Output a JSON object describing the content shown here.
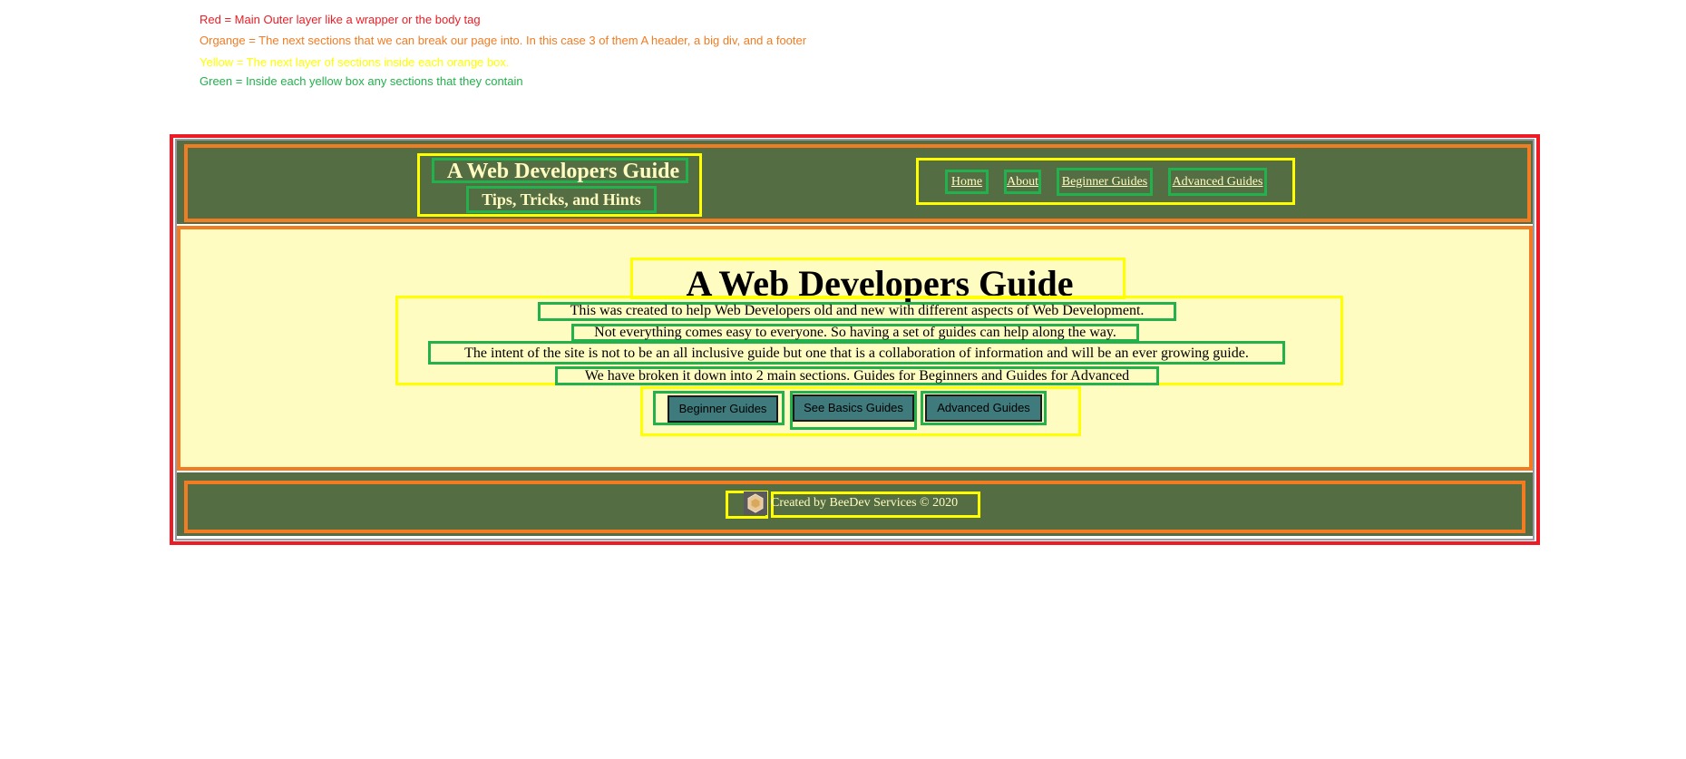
{
  "legend": {
    "red": {
      "text": "Red = Main Outer layer like a wrapper or the body tag",
      "color": "#ed1c24"
    },
    "orange": {
      "text": "Organge = The next sections that we can break our page into. In this case 3 of them A header, a big div, and a footer",
      "color": "#f27c22"
    },
    "yellow": {
      "text": "Yellow = The next layer of sections inside each orange box.",
      "color": "#ffff00"
    },
    "green": {
      "text": "Green = Inside each yellow box any sections that they contain",
      "color": "#22b14c"
    }
  },
  "header": {
    "title": "A Web Developers Guide",
    "subtitle": "Tips, Tricks, and Hints",
    "nav": [
      "Home",
      "About",
      "Beginner Guides",
      "Advanced Guides"
    ],
    "background": "#556d43",
    "text_color": "#fefcc0"
  },
  "main": {
    "title": "A Web Developers Guide",
    "paragraphs": [
      "This was created to help Web Developers old and new with different aspects of Web Development.",
      "Not everything comes easy to everyone. So having a set of guides can help along the way.",
      "The intent of the site is not to be an all inclusive guide but one that is a collaboration of information and will be an ever growing guide.",
      "We have broken it down into 2 main sections. Guides for Beginners and Guides for Advanced"
    ],
    "buttons": [
      "Beginner Guides",
      "See Basics Guides",
      "Advanced Guides"
    ],
    "background": "#fefcc0",
    "button_color": "#3f7a7d"
  },
  "footer": {
    "logo_icon": "bee-hexagon-logo-icon",
    "text": "Created by BeeDev Services © 2020"
  }
}
